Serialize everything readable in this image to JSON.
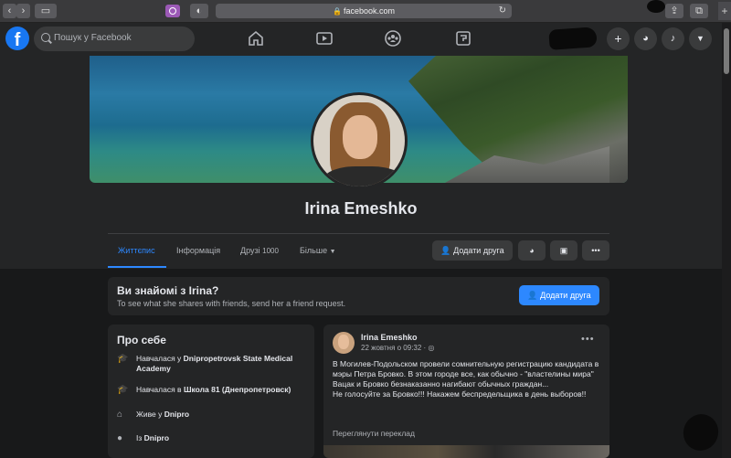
{
  "browser": {
    "url": "facebook.com"
  },
  "topbar": {
    "search_placeholder": "Пошук у Facebook",
    "nav_icons": [
      "home-icon",
      "watch-icon",
      "groups-icon",
      "gaming-icon"
    ],
    "right_icons": [
      "plus-icon",
      "messenger-icon",
      "notifications-icon",
      "account-menu-icon"
    ]
  },
  "profile": {
    "name": "Irina Emeshko",
    "tabs": [
      {
        "label": "Життєпис"
      },
      {
        "label": "Інформація"
      },
      {
        "label": "Друзі",
        "count": "1000"
      },
      {
        "label": "Більше"
      }
    ],
    "actions": {
      "add_friend": "Додати друга"
    }
  },
  "suggest": {
    "title": "Ви знайомі з Irina?",
    "subtitle": "To see what she shares with friends, send her a friend request.",
    "button": "Додати друга"
  },
  "about": {
    "title": "Про себе",
    "items": [
      {
        "prefix": "Навчалася у ",
        "bold": "Dnipropetrovsk State Medical Academy",
        "icon": "education-icon"
      },
      {
        "prefix": "Навчалася в ",
        "bold": "Школа 81 (Днепропетровск)",
        "icon": "education-icon"
      },
      {
        "prefix": "Живе у ",
        "bold": "Dnipro",
        "icon": "home-icon"
      },
      {
        "prefix": "Із ",
        "bold": "Dnipro",
        "icon": "location-icon"
      }
    ]
  },
  "post": {
    "author": "Irina Emeshko",
    "time": "22 жовтня о 09:32 · ",
    "text": "В Могилев-Подольском провели сомнительную регистрацию кандидата в мэры Петра Бровко. В этом городе все, как обычно - \"властелины мира\" Вацак и Бровко безнаказанно нагибают обычных граждан...\nНе голосуйте за Бровко!!! Накажем беспредельщика в день выборов!!",
    "translate": "Переглянути переклад"
  }
}
